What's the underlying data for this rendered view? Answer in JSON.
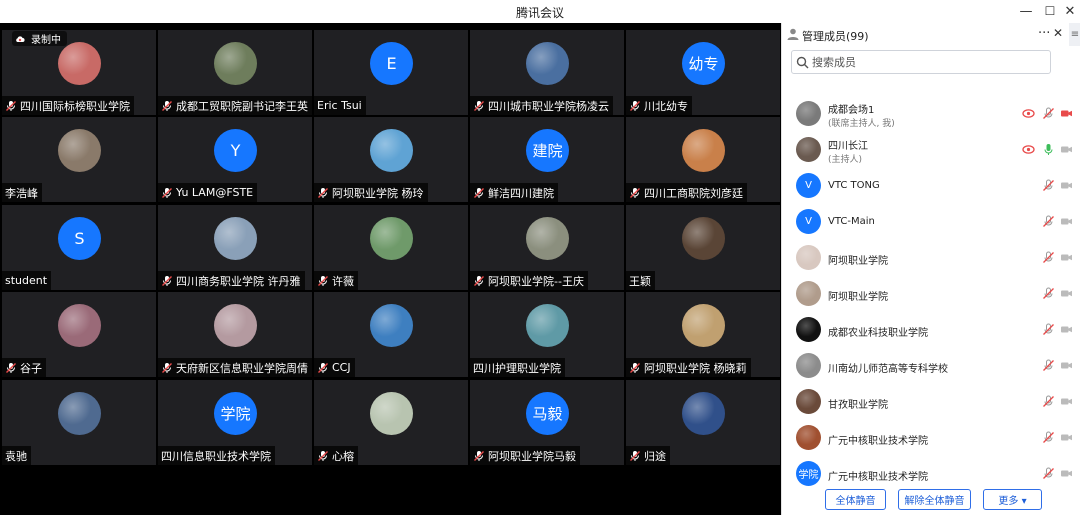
{
  "window": {
    "title": "腾讯会议",
    "minimize": "—",
    "maximize": "☐",
    "close": "✕"
  },
  "recording": {
    "label": "录制中"
  },
  "tiles": [
    {
      "name": "四川国际标榜职业学院",
      "avatar": "photo",
      "color": "#c86a66",
      "mic": true
    },
    {
      "name": "成都工贸职院副书记李王英",
      "avatar": "photo",
      "color": "#6e7d5c",
      "mic": true
    },
    {
      "name": "Eric Tsui",
      "avatar": "letter",
      "letter": "E",
      "mic": false
    },
    {
      "name": "四川城市职业学院杨凌云",
      "avatar": "photo",
      "color": "#4a6fa0",
      "mic": true
    },
    {
      "name": "川北幼专",
      "avatar": "letter",
      "letter": "幼专",
      "mic": true
    },
    {
      "name": "李浩峰",
      "avatar": "photo",
      "color": "#8a7a6a",
      "mic": false
    },
    {
      "name": "Yu LAM@FSTE",
      "avatar": "letter",
      "letter": "Y",
      "mic": true
    },
    {
      "name": "阿坝职业学院 杨玲",
      "avatar": "photo",
      "color": "#5fa3d4",
      "mic": true
    },
    {
      "name": "鲜洁四川建院",
      "avatar": "letter",
      "letter": "建院",
      "mic": true
    },
    {
      "name": "四川工商职院刘彦廷",
      "avatar": "photo",
      "color": "#c9804a",
      "mic": true
    },
    {
      "name": "student",
      "avatar": "letter",
      "letter": "S",
      "mic": false
    },
    {
      "name": "四川商务职业学院 许丹雅",
      "avatar": "photo",
      "color": "#8aa0b8",
      "mic": true
    },
    {
      "name": "许薇",
      "avatar": "photo",
      "color": "#6f9a6a",
      "mic": true
    },
    {
      "name": "阿坝职业学院--王庆",
      "avatar": "photo",
      "color": "#8b8f7e",
      "mic": true
    },
    {
      "name": "王颖",
      "avatar": "photo",
      "color": "#5a4536",
      "mic": false
    },
    {
      "name": "谷子",
      "avatar": "photo",
      "color": "#9a6a78",
      "mic": true
    },
    {
      "name": "天府新区信息职业学院周倩",
      "avatar": "photo",
      "color": "#b49aa0",
      "mic": true
    },
    {
      "name": "CCJ",
      "avatar": "photo",
      "color": "#3e7fc0",
      "mic": true
    },
    {
      "name": "四川护理职业学院",
      "avatar": "photo",
      "color": "#5f9aa6",
      "mic": false
    },
    {
      "name": "阿坝职业学院 杨晓莉",
      "avatar": "photo",
      "color": "#c0a070",
      "mic": true
    },
    {
      "name": "袁驰",
      "avatar": "photo",
      "color": "#4f6a90",
      "mic": false
    },
    {
      "name": "四川信息职业技术学院",
      "avatar": "letter",
      "letter": "学院",
      "mic": false
    },
    {
      "name": "心榕",
      "avatar": "photo",
      "color": "#b8c4b0",
      "mic": true
    },
    {
      "name": "阿坝职业学院马毅",
      "avatar": "letter",
      "letter": "马毅",
      "mic": true
    },
    {
      "name": "归途",
      "avatar": "photo",
      "color": "#30508a",
      "mic": true
    }
  ],
  "panel": {
    "title": "管理成员(99)",
    "more": "···",
    "close": "✕",
    "side": "≡",
    "search_placeholder": "搜索成员",
    "members": [
      {
        "name": "成都会场1",
        "role": "(联席主持人, 我)",
        "avatar": "photo",
        "color": "#7a7a7a",
        "share": true,
        "mic": "muted",
        "cam": "off-red"
      },
      {
        "name": "四川长江",
        "role": "(主持人)",
        "avatar": "photo",
        "color": "#6a5a50",
        "share": true,
        "mic": "on",
        "cam": "off"
      },
      {
        "name": "VTC TONG",
        "role": "",
        "avatar": "letter",
        "letter": "V",
        "share": false,
        "mic": "muted",
        "cam": "off"
      },
      {
        "name": "VTC-Main",
        "role": "",
        "avatar": "letter",
        "letter": "V",
        "share": false,
        "mic": "muted",
        "cam": "off"
      },
      {
        "name": "阿坝职业学院",
        "role": "",
        "avatar": "photo",
        "color": "#d8c8c0",
        "share": false,
        "mic": "muted",
        "cam": "off"
      },
      {
        "name": "阿坝职业学院",
        "role": "",
        "avatar": "photo",
        "color": "#b09c8c",
        "share": false,
        "mic": "muted",
        "cam": "off"
      },
      {
        "name": "成都农业科技职业学院",
        "role": "",
        "avatar": "photo",
        "color": "#111111",
        "share": false,
        "mic": "muted",
        "cam": "off"
      },
      {
        "name": "川南幼儿师范高等专科学校",
        "role": "",
        "avatar": "photo",
        "color": "#8c8c8c",
        "share": false,
        "mic": "muted",
        "cam": "off"
      },
      {
        "name": "甘孜职业学院",
        "role": "",
        "avatar": "photo",
        "color": "#6a4a3a",
        "share": false,
        "mic": "muted",
        "cam": "off"
      },
      {
        "name": "广元中核职业技术学院",
        "role": "",
        "avatar": "photo",
        "color": "#a05030",
        "share": false,
        "mic": "muted",
        "cam": "off"
      },
      {
        "name": "广元中核职业技术学院",
        "role": "",
        "avatar": "letter",
        "letter": "学院",
        "share": false,
        "mic": "muted",
        "cam": "off"
      }
    ],
    "buttons": {
      "mute_all": "全体静音",
      "unmute_all": "解除全体静音",
      "more": "更多 ▾"
    }
  },
  "colors": {
    "accent": "#1677ff",
    "muted_red": "#e84a4a",
    "mic_green": "#3cbd5a",
    "tile_bg": "#202023"
  }
}
